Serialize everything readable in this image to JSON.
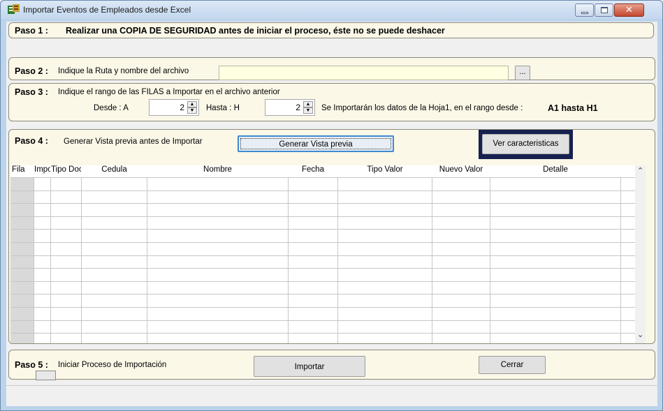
{
  "window": {
    "title": "Importar Eventos de Empleados desde Excel",
    "close_glyph": "✕"
  },
  "step1": {
    "label": "Paso 1 :",
    "text": "Realizar una COPIA DE SEGURIDAD antes de iniciar el proceso, éste no se puede deshacer"
  },
  "step2": {
    "label": "Paso 2 :",
    "text": "Indique la Ruta y nombre del archivo",
    "path_value": "",
    "browse_label": "..."
  },
  "step3": {
    "label": "Paso 3 :",
    "text": "Indique el rango de las FILAS a Importar en el archivo anterior",
    "from_label": "Desde :  A",
    "from_value": "2",
    "to_label": "Hasta :  H",
    "to_value": "2",
    "info_text": "Se Importarán los datos de la Hoja1,  en el rango desde :",
    "range_text": "A1 hasta H1"
  },
  "step4": {
    "label": "Paso 4 :",
    "text": "Generar Vista previa antes de Importar",
    "preview_button": "Generar Vista previa",
    "features_button": "Ver caracteristicas",
    "columns": [
      "Fila",
      "Impo",
      "Tipo Doc",
      "Cedula",
      "Nombre",
      "Fecha",
      "Tipo Valor",
      "Nuevo Valor",
      "Detalle"
    ],
    "row_count": 12
  },
  "step5": {
    "label": "Paso 5 :",
    "text": "Iniciar Proceso de Importación",
    "import_button": "Importar",
    "close_button": "Cerrar"
  },
  "icons": {
    "app": "excel-import-icon",
    "scroll_up": "▲",
    "scroll_down": "▼",
    "scroll_left": "<",
    "scroll_right": ">"
  }
}
